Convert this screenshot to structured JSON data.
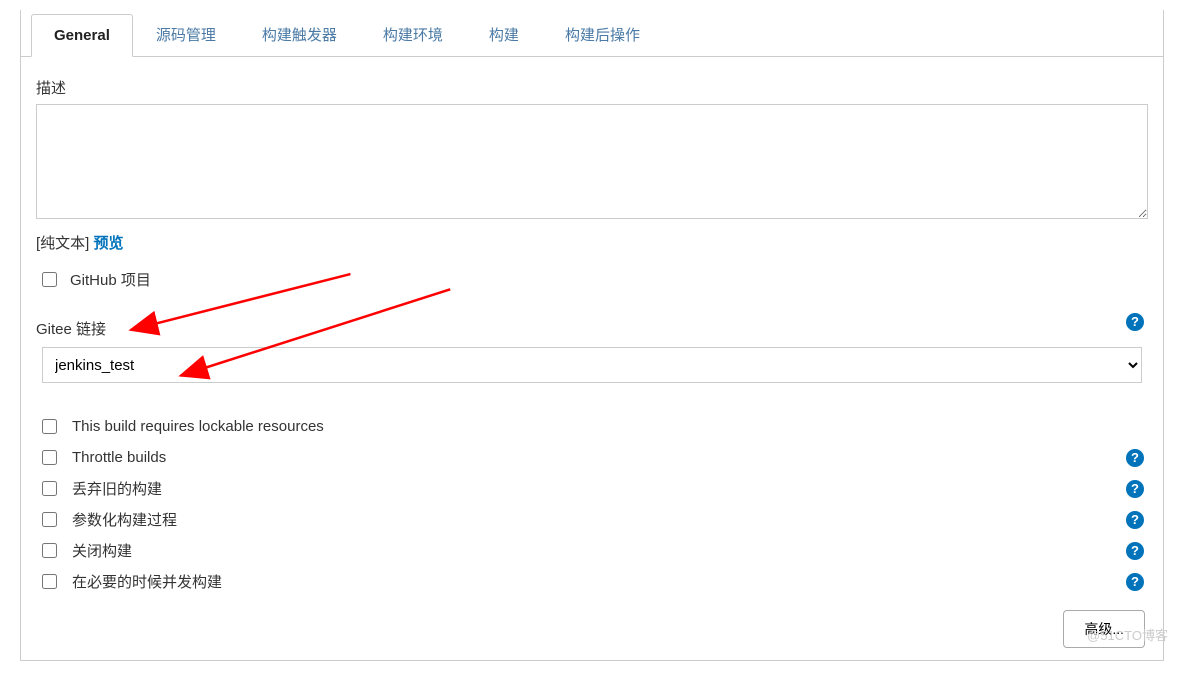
{
  "tabs": {
    "general": "General",
    "scm": "源码管理",
    "triggers": "构建触发器",
    "env": "构建环境",
    "build": "构建",
    "post": "构建后操作"
  },
  "desc": {
    "label": "描述",
    "value": ""
  },
  "format": {
    "plain": "[纯文本]",
    "preview": "预览"
  },
  "github_project": "GitHub 项目",
  "gitee_link_label": "Gitee 链接",
  "gitee_select_value": "jenkins_test",
  "options": {
    "lockable": "This build requires lockable resources",
    "throttle": "Throttle builds",
    "discard": "丢弃旧的构建",
    "parametrize": "参数化构建过程",
    "disable": "关闭构建",
    "concurrent": "在必要的时候并发构建"
  },
  "advanced_btn": "高级...",
  "help_glyph": "?",
  "watermark": "@51CTO博客"
}
